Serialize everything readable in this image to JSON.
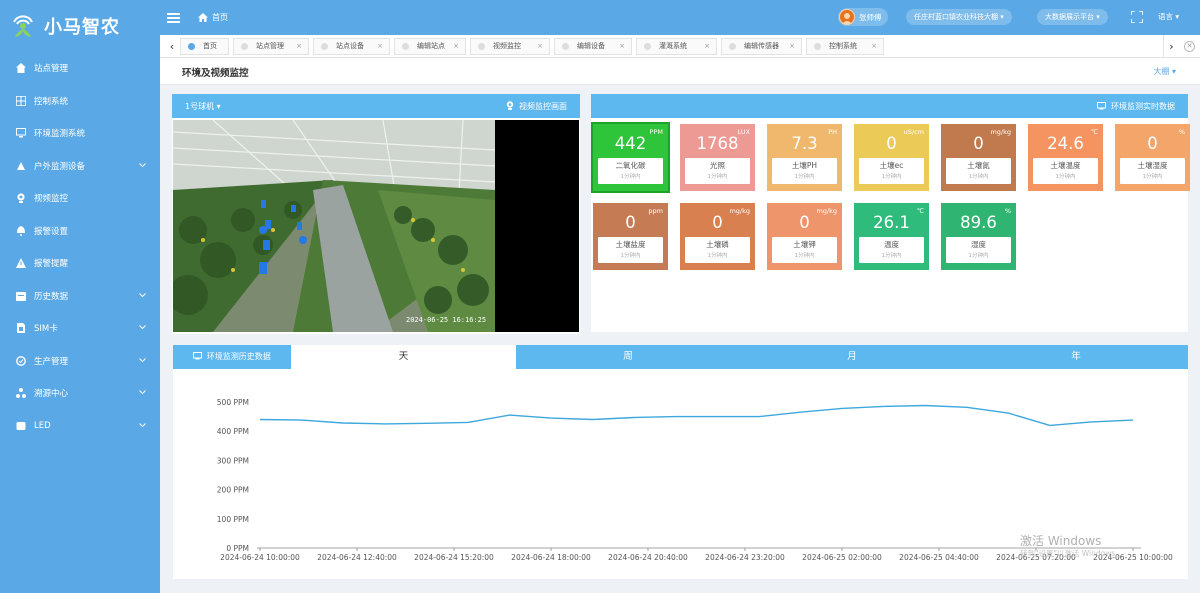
{
  "app": {
    "name": "小马智农"
  },
  "sidebar": {
    "items": [
      {
        "label": "站点管理",
        "icon": "home-icon",
        "arrow": false
      },
      {
        "label": "控制系统",
        "icon": "grid-icon",
        "arrow": false
      },
      {
        "label": "环境监测系统",
        "icon": "monitor-icon",
        "arrow": false
      },
      {
        "label": "户外监测设备",
        "icon": "device-icon",
        "arrow": true
      },
      {
        "label": "视频监控",
        "icon": "camera-icon",
        "arrow": false
      },
      {
        "label": "报警设置",
        "icon": "bell-icon",
        "arrow": false
      },
      {
        "label": "报警提醒",
        "icon": "warning-icon",
        "arrow": false
      },
      {
        "label": "历史数据",
        "icon": "history-icon",
        "arrow": true
      },
      {
        "label": "SIM卡",
        "icon": "sim-icon",
        "arrow": true
      },
      {
        "label": "生产管理",
        "icon": "production-icon",
        "arrow": true
      },
      {
        "label": "溯源中心",
        "icon": "trace-icon",
        "arrow": true
      },
      {
        "label": "LED",
        "icon": "led-icon",
        "arrow": true
      }
    ]
  },
  "topbar": {
    "home": "首页",
    "user": "张师傅",
    "org": "任庄村蓝口镇农业科技大棚",
    "bigscreen": "大数据展示平台",
    "lang": "语言"
  },
  "tabs": [
    {
      "label": "首页",
      "active": true
    },
    {
      "label": "站点管理"
    },
    {
      "label": "站点设备"
    },
    {
      "label": "编辑站点"
    },
    {
      "label": "视频监控"
    },
    {
      "label": "编辑设备"
    },
    {
      "label": "灌溉系统"
    },
    {
      "label": "编辑传感器"
    },
    {
      "label": "控制系统"
    }
  ],
  "page": {
    "title": "环境及视频监控",
    "greenhouse": "大棚"
  },
  "video": {
    "camera": "1号球机",
    "title": "视频监控画面",
    "timestamp": "2024-06-25 16:16:25"
  },
  "realtime": {
    "title": "环境监测实时数据",
    "cards": [
      {
        "value": "442",
        "unit": "PPM",
        "label": "二氧化碳",
        "sub": "1分钟内",
        "color": "#2fc53a",
        "active": true
      },
      {
        "value": "1768",
        "unit": "LUX",
        "label": "光照",
        "sub": "1分钟内",
        "color": "#ee9a94"
      },
      {
        "value": "7.3",
        "unit": "PH",
        "label": "土壤PH",
        "sub": "1分钟内",
        "color": "#f0b86d"
      },
      {
        "value": "0",
        "unit": "uS/cm",
        "label": "土壤ec",
        "sub": "1分钟内",
        "color": "#ecca58"
      },
      {
        "value": "0",
        "unit": "mg/kg",
        "label": "土壤氮",
        "sub": "1分钟内",
        "color": "#c07a4e"
      },
      {
        "value": "24.6",
        "unit": "℃",
        "label": "土壤温度",
        "sub": "1分钟内",
        "color": "#f59460"
      },
      {
        "value": "0",
        "unit": "%",
        "label": "土壤湿度",
        "sub": "1分钟内",
        "color": "#f3a56a"
      },
      {
        "value": "0",
        "unit": "ppm",
        "label": "土壤盐度",
        "sub": "1分钟内",
        "color": "#c57c55"
      },
      {
        "value": "0",
        "unit": "mg/kg",
        "label": "土壤磷",
        "sub": "1分钟内",
        "color": "#d8804f"
      },
      {
        "value": "0",
        "unit": "mg/kg",
        "label": "土壤钾",
        "sub": "1分钟内",
        "color": "#ee956b"
      },
      {
        "value": "26.1",
        "unit": "℃",
        "label": "温度",
        "sub": "1分钟内",
        "color": "#2fbb7b"
      },
      {
        "value": "89.6",
        "unit": "%",
        "label": "湿度",
        "sub": "1分钟内",
        "color": "#2fb571"
      }
    ]
  },
  "history": {
    "title": "环境监测历史数据",
    "tabs": [
      "天",
      "周",
      "月",
      "年"
    ],
    "active_tab": "天"
  },
  "chart_data": {
    "type": "line",
    "x": [
      "2024-06-24 10:00:00",
      "2024-06-24 12:40:00",
      "2024-06-24 15:20:00",
      "2024-06-24 18:00:00",
      "2024-06-24 20:40:00",
      "2024-06-24 23:20:00",
      "2024-06-25 02:00:00",
      "2024-06-25 04:40:00",
      "2024-06-25 07:20:00",
      "2024-06-25 10:00:00"
    ],
    "series": [
      {
        "values": [
          440,
          438,
          428,
          425,
          427,
          430,
          455,
          445,
          440,
          447,
          450,
          450,
          450,
          465,
          478,
          485,
          488,
          482,
          462,
          420,
          432,
          438
        ]
      }
    ],
    "yticks": [
      "0 PPM",
      "100 PPM",
      "200 PPM",
      "300 PPM",
      "400 PPM",
      "500 PPM"
    ],
    "ylim": [
      0,
      500
    ],
    "color": "#3ea7dd"
  },
  "watermark": {
    "line1": "激活 Windows",
    "line2": "转到\"设置\"以激活 Windows。"
  }
}
